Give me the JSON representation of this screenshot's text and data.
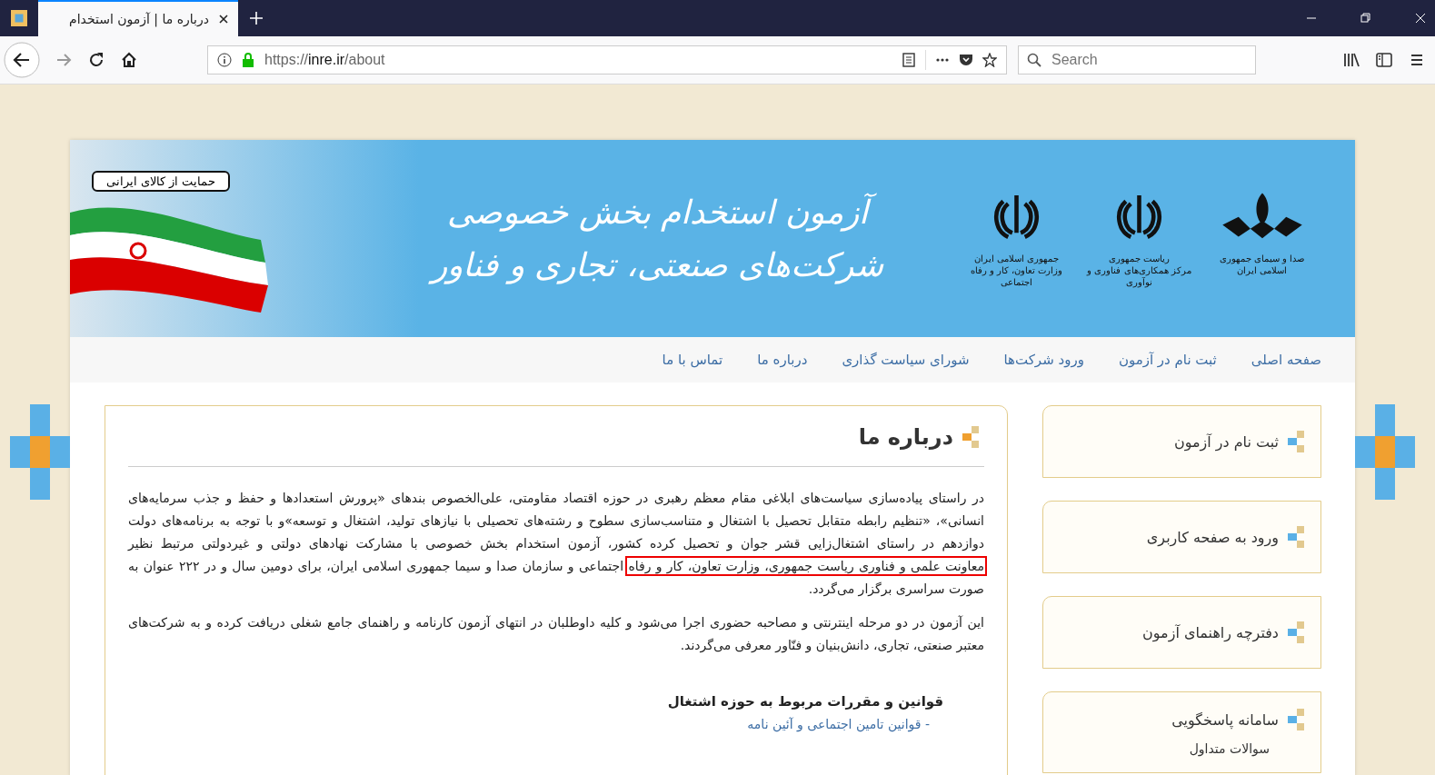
{
  "browser": {
    "tab": {
      "title": "درباره ما | آزمون استخدام",
      "selected": true
    },
    "url": {
      "scheme": "https://",
      "host": "inre.ir",
      "path": "/about"
    },
    "search": {
      "placeholder": "Search"
    }
  },
  "banner": {
    "title_line_1": "آزمون استخدام بخش خصوصی",
    "title_line_2": "شرکت‌های صنعتی، تجاری و فناور",
    "flag_badge": "حمایت از کالای ایرانی",
    "logos": [
      {
        "kind": "broadcast",
        "lines": [
          "صدا و سیمای جمهوری اسلامی ایران"
        ]
      },
      {
        "kind": "emblem",
        "lines": [
          "ریاست جمهوری",
          "مرکز همکاری‌های فناوری و نوآوری"
        ]
      },
      {
        "kind": "emblem",
        "lines": [
          "جمهوری اسلامی ایران",
          "وزارت تعاون، کار و رفاه اجتماعی"
        ]
      }
    ]
  },
  "nav": [
    "صفحه اصلی",
    "ثبت نام در آزمون",
    "ورود شرکت‌ها",
    "شورای سیاست گذاری",
    "درباره ما",
    "تماس با ما"
  ],
  "sidebar": [
    {
      "title": "ثبت نام در آزمون"
    },
    {
      "title": "ورود به صفحه کاربری"
    },
    {
      "title": "دفترچه راهنمای آزمون"
    },
    {
      "title": "سامانه پاسخگویی",
      "sub": "سوالات متداول"
    }
  ],
  "content": {
    "title": "درباره ما",
    "paragraphs": [
      {
        "before": "در راستای پیاده‌سازی سیاست‌های ابلاغی مقام معظم رهبری در حوزه اقتصاد مقاومتی، علی‌الخصوص بندهای «پرورش استعدادها و حفظ و جذب سرمایه‌های انسانی»، «تنظیم رابطه متقابل تحصیل با اشتغال و متناسب‌سازی سطوح و رشته‌های تحصیلی با نیازهای تولید، اشتغال و توسعه»و با توجه به برنامه‌های دولت دوازدهم در راستای اشتغال‌زایی قشر جوان و تحصیل کرده کشور، آزمون استخدام بخش خصوصی با مشارکت نهادهای دولتی و غیردولتی مرتبط نظیر ",
        "highlighted": "معاونت علمی و فناوری ریاست جمهوری، وزارت تعاون، کار و رفاه",
        "after": " اجتماعی و سازمان صدا و سیما جمهوری اسلامی ایران، برای دومین سال و در ۲۲۲ عنوان به صورت سراسری برگزار می‌گردد."
      },
      {
        "before": "این آزمون در دو مرحله اینترنتی و مصاحبه حضوری اجرا می‌شود و کلیه داوطلبان در انتهای آزمون کارنامه و راهنمای جامع شغلی دریافت کرده و به شرکت‌های معتبر صنعتی، تجاری، دانش‌بنیان و فنّاور معرفی می‌گردند."
      }
    ],
    "subheading": "قوانین و مقررات مربوط به حوزه اشتغال",
    "links": [
      "- قوانین تامین اجتماعی و آئین نامه"
    ]
  }
}
